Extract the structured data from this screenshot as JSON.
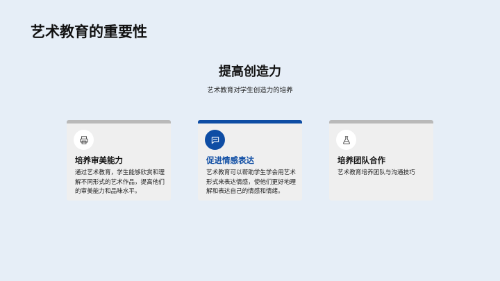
{
  "page": {
    "title": "艺术教育的重要性"
  },
  "section": {
    "title": "提高创造力",
    "subtitle": "艺术教育对学生创造力的培养"
  },
  "cards": [
    {
      "icon": "printer-icon",
      "title": "培养审美能力",
      "text": "通过艺术教育，学生能够欣赏和理解不同形式的艺术作品，提高他们的审美能力和品味水平。",
      "active": false
    },
    {
      "icon": "message-icon",
      "title": "促进情感表达",
      "text": "艺术教育可以帮助学生学会用艺术形式来表达情感，使他们更好地理解和表达自己的情感和情绪。",
      "active": true
    },
    {
      "icon": "flask-icon",
      "title": "培养团队合作",
      "text": "艺术教育培养团队与沟通技巧",
      "active": false
    }
  ],
  "colors": {
    "accent": "#0e4da4",
    "card_bg": "#efefef",
    "card_bar": "#b9b9b9",
    "page_bg": "#e6eef7"
  }
}
